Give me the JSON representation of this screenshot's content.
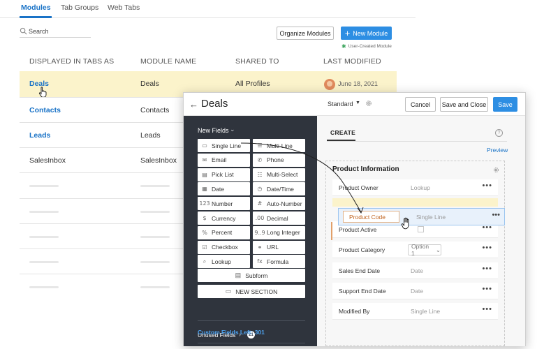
{
  "tabs": [
    "Modules",
    "Tab Groups",
    "Web Tabs"
  ],
  "search": {
    "placeholder": "Search"
  },
  "toolbar": {
    "organize_label": "Organize Modules",
    "new_label": "New Module",
    "legend_label": "User-Created Module"
  },
  "table": {
    "headers": [
      "DISPLAYED IN TABS AS",
      "MODULE NAME",
      "SHARED TO",
      "LAST MODIFIED"
    ],
    "rows": [
      {
        "display": "Deals",
        "module": "Deals",
        "shared": "All Profiles",
        "modified": "June 18, 2021"
      },
      {
        "display": "Contacts",
        "module": "Contacts"
      },
      {
        "display": "Leads",
        "module": "Leads"
      },
      {
        "display": "SalesInbox",
        "module": "SalesInbox"
      }
    ]
  },
  "modal": {
    "title": "Deals",
    "layout": "Standard",
    "buttons": {
      "cancel": "Cancel",
      "save_close": "Save and Close",
      "save": "Save"
    },
    "new_fields_label": "New Fields",
    "fields": [
      {
        "label": "Single Line",
        "icon": "single-line-icon"
      },
      {
        "label": "Multi-Line",
        "icon": "multi-line-icon"
      },
      {
        "label": "Email",
        "icon": "email-icon"
      },
      {
        "label": "Phone",
        "icon": "phone-icon"
      },
      {
        "label": "Pick List",
        "icon": "picklist-icon"
      },
      {
        "label": "Multi-Select",
        "icon": "multiselect-icon"
      },
      {
        "label": "Date",
        "icon": "calendar-icon"
      },
      {
        "label": "Date/Time",
        "icon": "datetime-icon"
      },
      {
        "label": "Number",
        "icon": "number-icon",
        "glyph": "123"
      },
      {
        "label": "Auto-Number",
        "icon": "auto-number-icon"
      },
      {
        "label": "Currency",
        "icon": "currency-icon",
        "glyph": "$"
      },
      {
        "label": "Decimal",
        "icon": "decimal-icon",
        "glyph": ".00"
      },
      {
        "label": "Percent",
        "icon": "percent-icon",
        "glyph": "%"
      },
      {
        "label": "Long Integer",
        "icon": "long-integer-icon",
        "glyph": "9..9"
      },
      {
        "label": "Checkbox",
        "icon": "checkbox-icon"
      },
      {
        "label": "URL",
        "icon": "url-icon"
      },
      {
        "label": "Lookup",
        "icon": "lookup-icon"
      },
      {
        "label": "Formula",
        "icon": "formula-icon",
        "glyph": "fx"
      }
    ],
    "subform_label": "Subform",
    "new_section_label": "NEW SECTION",
    "unused_label": "Unused Fields",
    "unused_count": "21",
    "custom_left": "Custom Fields Left: 301",
    "create_tab": "CREATE",
    "help_glyph": "?",
    "preview": "Preview",
    "section_title": "Product Information",
    "dragged": {
      "label": "Product Code",
      "type": "Single Line"
    },
    "layout_rows": [
      {
        "label": "Product Owner",
        "type": "Lookup"
      },
      {
        "label": "Product Active",
        "type": ""
      },
      {
        "label": "Product Category",
        "type": "Option 1"
      },
      {
        "label": "Sales End Date",
        "type": "Date"
      },
      {
        "label": "Support End Date",
        "type": "Date"
      },
      {
        "label": "Modified By",
        "type": "Single Line"
      }
    ]
  },
  "colors": {
    "accent": "#2d8ee3",
    "link": "#1a73c7",
    "highlight": "#fbf3cb",
    "panel": "#2f343d",
    "user_created": "#3aa35b"
  }
}
